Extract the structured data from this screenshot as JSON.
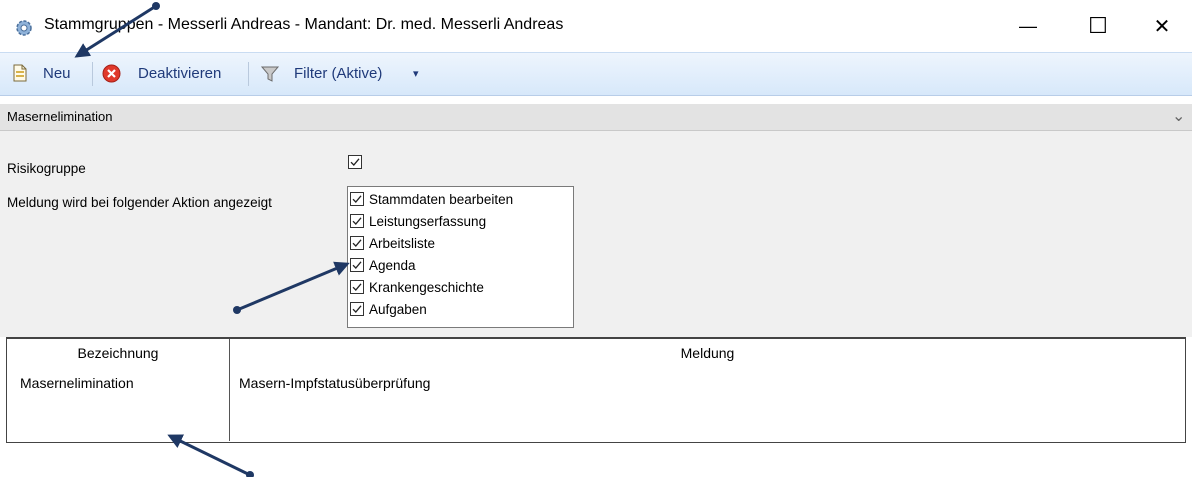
{
  "window": {
    "title": "Stammgruppen - Messerli Andreas - Mandant: Dr. med. Messerli Andreas",
    "minimize_glyph": "—",
    "maximize_glyph": "☐",
    "close_glyph": "✕"
  },
  "toolbar": {
    "new_label": "Neu",
    "deactivate_label": "Deaktivieren",
    "filter_label": "Filter (Aktive)",
    "dropdown_glyph": "▾"
  },
  "section": {
    "title": "Masernelimination",
    "chevron_glyph": "⌄"
  },
  "form": {
    "risk_group_label": "Risikogruppe",
    "risk_group_checked": true,
    "action_label": "Meldung wird bei folgender Aktion angezeigt",
    "actions": [
      {
        "label": "Stammdaten bearbeiten",
        "checked": true
      },
      {
        "label": "Leistungserfassung",
        "checked": true
      },
      {
        "label": "Arbeitsliste",
        "checked": true
      },
      {
        "label": "Agenda",
        "checked": true
      },
      {
        "label": "Krankengeschichte",
        "checked": true
      },
      {
        "label": "Aufgaben",
        "checked": true
      }
    ]
  },
  "table": {
    "columns": [
      "Bezeichnung",
      "Meldung"
    ],
    "rows": [
      {
        "bezeichnung": "Masernelimination",
        "meldung": "Masern-Impfstatusüberprüfung"
      }
    ]
  },
  "colors": {
    "annotation_arrow": "#1f3864",
    "toolbar_text": "#1f3a7a",
    "deactivate_icon": "#e0392b"
  },
  "icons": {
    "app": "gear-icon",
    "new": "new-document-icon",
    "deactivate": "deactivate-icon",
    "filter": "filter-icon"
  }
}
